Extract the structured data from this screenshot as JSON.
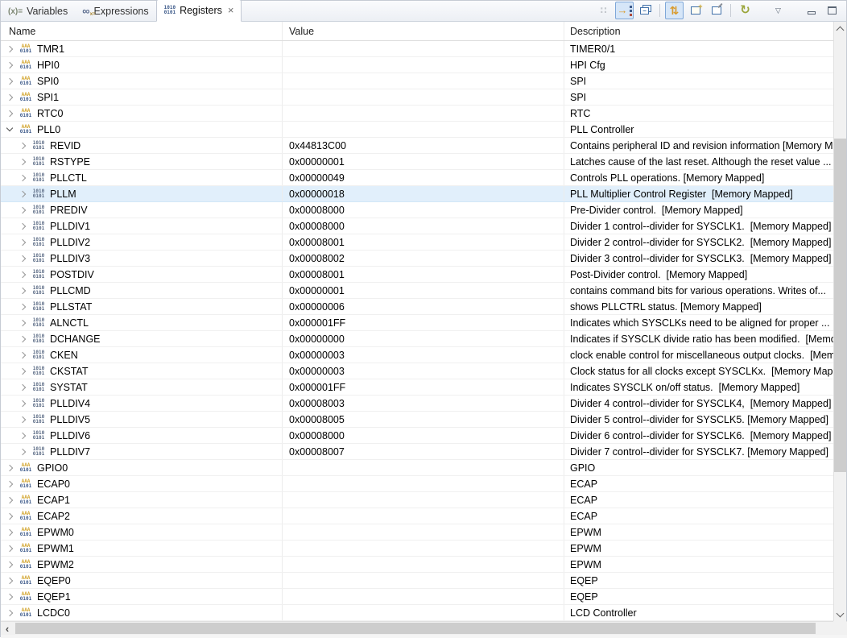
{
  "tabs": [
    {
      "label": "Variables",
      "active": false
    },
    {
      "label": "Expressions",
      "active": false
    },
    {
      "label": "Registers",
      "active": true,
      "closable": true
    }
  ],
  "icons": {
    "variables": "(x)=",
    "expressions": "∞",
    "expressions_sub": "x=",
    "registers_top": "1010",
    "registers_bottom": "0101",
    "close": "×",
    "group_top": "AAA",
    "reg_top": "1010",
    "reg_bottom": "0101",
    "format": "∷",
    "link_arrow": "→",
    "minus": "−",
    "continuous_refresh": "⇅",
    "plus": "+",
    "refresh": "↻",
    "view_menu": "▽",
    "hscroll_left": "‹",
    "hscroll_right": "›"
  },
  "toolbar": {
    "buttons": [
      {
        "id": "number-format",
        "disabled": true
      },
      {
        "id": "link-with-debug-view",
        "toggled": true
      },
      {
        "id": "collapse-all"
      },
      {
        "id": "continuous-refresh",
        "toggled": true
      },
      {
        "id": "open-new-view"
      },
      {
        "id": "pin-to-debug-context"
      },
      {
        "id": "refresh"
      },
      {
        "id": "view-menu"
      },
      {
        "id": "minimize"
      },
      {
        "id": "maximize"
      }
    ]
  },
  "colors": {
    "selection_bg": "#e1effb",
    "toggle_bg": "#d6e6f8",
    "toggle_border": "#7fa8d9",
    "icon_yellow": "#d99a2b",
    "icon_blue": "#3d5a8a"
  },
  "table": {
    "columns": [
      "Name",
      "Value",
      "Description"
    ],
    "selected_register": "PLLM",
    "rows": [
      {
        "name": "TMR1",
        "level": 0,
        "expanded": false,
        "value": "",
        "desc": "TIMER0/1"
      },
      {
        "name": "HPI0",
        "level": 0,
        "expanded": false,
        "value": "",
        "desc": "HPI Cfg"
      },
      {
        "name": "SPI0",
        "level": 0,
        "expanded": false,
        "value": "",
        "desc": "SPI"
      },
      {
        "name": "SPI1",
        "level": 0,
        "expanded": false,
        "value": "",
        "desc": "SPI"
      },
      {
        "name": "RTC0",
        "level": 0,
        "expanded": false,
        "value": "",
        "desc": "RTC"
      },
      {
        "name": "PLL0",
        "level": 0,
        "expanded": true,
        "value": "",
        "desc": "PLL Controller"
      },
      {
        "name": "REVID",
        "level": 1,
        "value": "0x44813C00",
        "desc": "Contains peripheral ID and revision information [Memory Mapped]"
      },
      {
        "name": "RSTYPE",
        "level": 1,
        "value": "0x00000001",
        "desc": "Latches cause of the last reset. Although the reset value ..."
      },
      {
        "name": "PLLCTL",
        "level": 1,
        "value": "0x00000049",
        "desc": "Controls PLL operations. [Memory Mapped]"
      },
      {
        "name": "PLLM",
        "level": 1,
        "value": "0x00000018",
        "desc": "PLL Multiplier Control Register  [Memory Mapped]",
        "selected": true
      },
      {
        "name": "PREDIV",
        "level": 1,
        "value": "0x00008000",
        "desc": "Pre-Divider control.  [Memory Mapped]"
      },
      {
        "name": "PLLDIV1",
        "level": 1,
        "value": "0x00008000",
        "desc": "Divider 1 control--divider for SYSCLK1.  [Memory Mapped]"
      },
      {
        "name": "PLLDIV2",
        "level": 1,
        "value": "0x00008001",
        "desc": "Divider 2 control--divider for SYSCLK2.  [Memory Mapped]"
      },
      {
        "name": "PLLDIV3",
        "level": 1,
        "value": "0x00008002",
        "desc": "Divider 3 control--divider for SYSCLK3.  [Memory Mapped]"
      },
      {
        "name": "POSTDIV",
        "level": 1,
        "value": "0x00008001",
        "desc": "Post-Divider control.  [Memory Mapped]"
      },
      {
        "name": "PLLCMD",
        "level": 1,
        "value": "0x00000001",
        "desc": "contains command bits for various operations. Writes of..."
      },
      {
        "name": "PLLSTAT",
        "level": 1,
        "value": "0x00000006",
        "desc": "shows PLLCTRL status. [Memory Mapped]"
      },
      {
        "name": "ALNCTL",
        "level": 1,
        "value": "0x000001FF",
        "desc": "Indicates which SYSCLKs need to be aligned for proper ..."
      },
      {
        "name": "DCHANGE",
        "level": 1,
        "value": "0x00000000",
        "desc": "Indicates if SYSCLK divide ratio has been modified.  [Memory Mapped]"
      },
      {
        "name": "CKEN",
        "level": 1,
        "value": "0x00000003",
        "desc": "clock enable control for miscellaneous output clocks.  [Memory Mapped]"
      },
      {
        "name": "CKSTAT",
        "level": 1,
        "value": "0x00000003",
        "desc": "Clock status for all clocks except SYSCLKx.  [Memory Mapped]"
      },
      {
        "name": "SYSTAT",
        "level": 1,
        "value": "0x000001FF",
        "desc": "Indicates SYSCLK on/off status.  [Memory Mapped]"
      },
      {
        "name": "PLLDIV4",
        "level": 1,
        "value": "0x00008003",
        "desc": "Divider 4 control--divider for SYSCLK4,  [Memory Mapped]"
      },
      {
        "name": "PLLDIV5",
        "level": 1,
        "value": "0x00008005",
        "desc": "Divider 5 control--divider for SYSCLK5. [Memory Mapped]"
      },
      {
        "name": "PLLDIV6",
        "level": 1,
        "value": "0x00008000",
        "desc": "Divider 6 control--divider for SYSCLK6.  [Memory Mapped]"
      },
      {
        "name": "PLLDIV7",
        "level": 1,
        "value": "0x00008007",
        "desc": "Divider 7 control--divider for SYSCLK7. [Memory Mapped]"
      },
      {
        "name": "GPIO0",
        "level": 0,
        "expanded": false,
        "value": "",
        "desc": "GPIO"
      },
      {
        "name": "ECAP0",
        "level": 0,
        "expanded": false,
        "value": "",
        "desc": "ECAP"
      },
      {
        "name": "ECAP1",
        "level": 0,
        "expanded": false,
        "value": "",
        "desc": "ECAP"
      },
      {
        "name": "ECAP2",
        "level": 0,
        "expanded": false,
        "value": "",
        "desc": "ECAP"
      },
      {
        "name": "EPWM0",
        "level": 0,
        "expanded": false,
        "value": "",
        "desc": "EPWM"
      },
      {
        "name": "EPWM1",
        "level": 0,
        "expanded": false,
        "value": "",
        "desc": "EPWM"
      },
      {
        "name": "EPWM2",
        "level": 0,
        "expanded": false,
        "value": "",
        "desc": "EPWM"
      },
      {
        "name": "EQEP0",
        "level": 0,
        "expanded": false,
        "value": "",
        "desc": "EQEP"
      },
      {
        "name": "EQEP1",
        "level": 0,
        "expanded": false,
        "value": "",
        "desc": "EQEP"
      },
      {
        "name": "LCDC0",
        "level": 0,
        "expanded": false,
        "value": "",
        "desc": "LCD Controller"
      }
    ]
  }
}
